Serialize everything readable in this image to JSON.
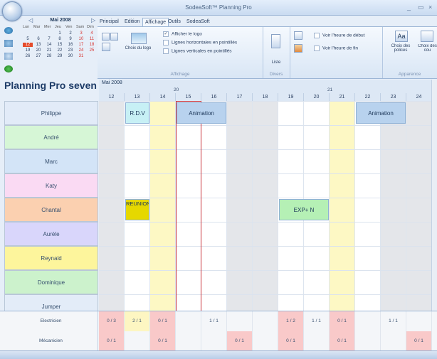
{
  "app": {
    "title": "SodeaSoft™ Planning Pro"
  },
  "window_buttons": [
    "_",
    "▭",
    "×"
  ],
  "calendar": {
    "month": "Mai 2008",
    "prev": "◁",
    "next": "▷",
    "dow": [
      "Lun",
      "Mar",
      "Mer",
      "Jeu",
      "Ven",
      "Sam",
      "Dim"
    ],
    "weeks": [
      [
        "",
        "",
        "",
        "1",
        "2",
        "3",
        "4"
      ],
      [
        "5",
        "6",
        "7",
        "8",
        "9",
        "10",
        "11"
      ],
      [
        "12",
        "13",
        "14",
        "15",
        "16",
        "17",
        "18"
      ],
      [
        "19",
        "20",
        "21",
        "22",
        "23",
        "24",
        "25"
      ],
      [
        "26",
        "27",
        "28",
        "29",
        "30",
        "31",
        ""
      ]
    ],
    "today": "12",
    "weekend_color": "#d8322e"
  },
  "ribbon": {
    "tabs": [
      "Principal",
      "Edition",
      "Affichage",
      "Outils",
      "SodeaSoft"
    ],
    "active_tab": "Affichage",
    "affichage_group": "Affichage",
    "logo_button": "Choix du logo",
    "checks": [
      {
        "label": "Afficher le logo",
        "checked": true
      },
      {
        "label": "Lignes horizontales en pointillés",
        "checked": false
      },
      {
        "label": "Lignes verticales en pointillés",
        "checked": false
      }
    ],
    "divers_group": "Divers",
    "liste_button": "Liste",
    "time_checks": [
      {
        "label": "Voir l'heure de début",
        "checked": false
      },
      {
        "label": "Voir l'heure de fin",
        "checked": false
      }
    ],
    "fonts_button": "Choix des polices",
    "fonts_glyph": "Aa",
    "colors_button": "Choix des cou",
    "apparence_group": "Apparence"
  },
  "planning": {
    "title": "Planning Pro seven",
    "month_label": "Mai 2008",
    "weeks": [
      {
        "num": "20"
      },
      {
        "num": "21"
      }
    ],
    "days": [
      "12",
      "13",
      "14",
      "15",
      "16",
      "17",
      "18",
      "19",
      "20",
      "21",
      "22",
      "23",
      "24"
    ],
    "day_kinds": [
      "grey",
      "normal",
      "yellow",
      "normal",
      "normal",
      "grey",
      "grey",
      "normal",
      "normal",
      "yellow",
      "normal",
      "grey",
      "grey"
    ],
    "resources": [
      {
        "name": "Philippe",
        "color": "#e2ebf8"
      },
      {
        "name": "André",
        "color": "#d6f6d6"
      },
      {
        "name": "Marc",
        "color": "#d3e4f7"
      },
      {
        "name": "Katy",
        "color": "#fadaf3"
      },
      {
        "name": "Chantal",
        "color": "#fbd0b0"
      },
      {
        "name": "Aurèle",
        "color": "#d9d6fb"
      },
      {
        "name": "Reynald",
        "color": "#fdf59c"
      },
      {
        "name": "Dominique",
        "color": "#ccf2cc"
      },
      {
        "name": "Jumper",
        "color": "#e3ecf8"
      }
    ],
    "events": [
      {
        "label": "R.D.V",
        "row": 0,
        "day": 1,
        "span": 1,
        "color": "#c7f0f5"
      },
      {
        "label": "Animation",
        "row": 0,
        "day": 3,
        "span": 2,
        "color": "#b8d2ee"
      },
      {
        "label": "Animation",
        "row": 0,
        "day": 10,
        "span": 2,
        "color": "#b8d2ee"
      },
      {
        "label": "REUNION",
        "row": 4,
        "day": 1,
        "span": 1,
        "color": "#e6d800"
      },
      {
        "label": "EXP+ N",
        "row": 4,
        "day": 7,
        "span": 2,
        "color": "#b5f0b5"
      }
    ]
  },
  "counters": [
    {
      "label": "Electricien",
      "values": [
        "0 / 3",
        "2 / 1",
        "0 / 1",
        "",
        "1 / 1",
        "",
        "",
        "1 / 2",
        "1 / 1",
        "0 / 1",
        "",
        "1 / 1",
        ""
      ],
      "kinds": [
        "pink",
        "yel",
        "pink",
        "",
        "",
        "",
        "",
        "pink",
        "",
        "pink",
        "",
        "",
        ""
      ]
    },
    {
      "label": "Mécanicien",
      "values": [
        "0 / 1",
        "",
        "0 / 1",
        "",
        "",
        "0 / 1",
        "",
        "0 / 1",
        "",
        "0 / 1",
        "",
        "",
        "0 / 1"
      ],
      "kinds": [
        "pink",
        "",
        "pink",
        "",
        "",
        "pink",
        "",
        "pink",
        "",
        "pink",
        "",
        "",
        "pink"
      ]
    }
  ]
}
